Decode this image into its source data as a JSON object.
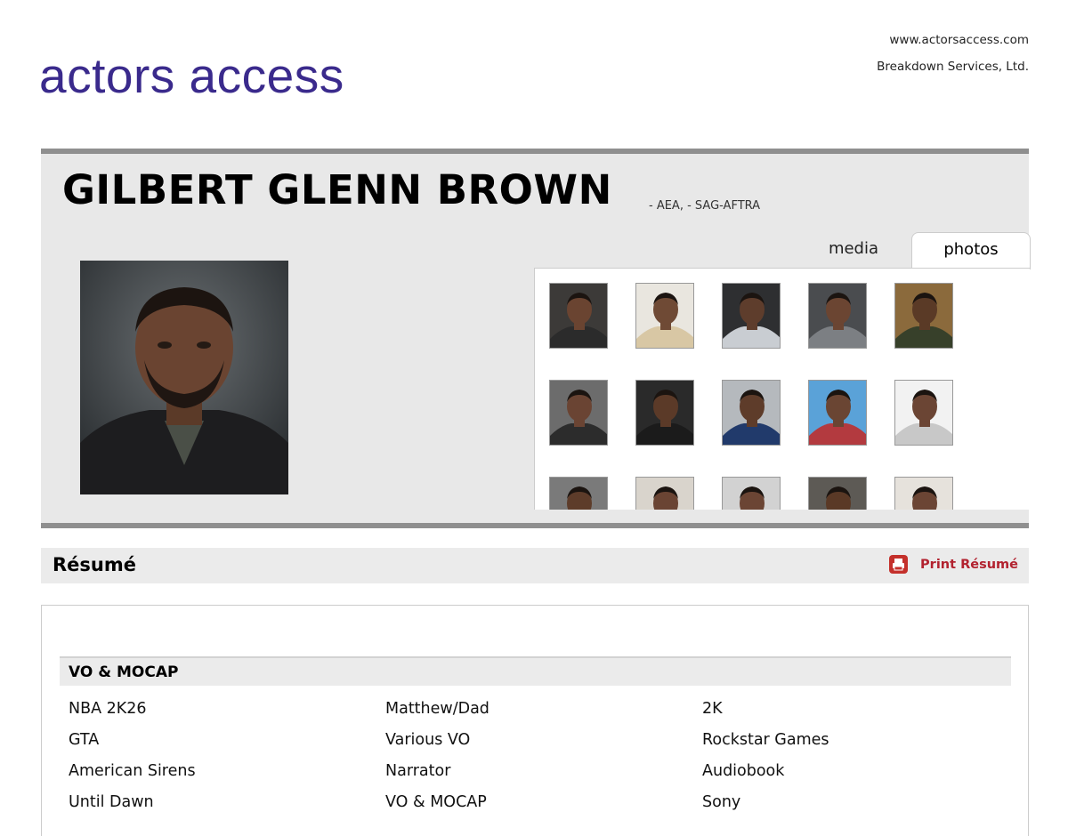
{
  "site": {
    "logo": "actors access",
    "url": "www.actorsaccess.com",
    "company": "Breakdown Services, Ltd."
  },
  "profile": {
    "name": "GILBERT GLENN BROWN",
    "unions": "- AEA, - SAG-AFTRA"
  },
  "tabs": {
    "media": "media",
    "photos": "photos",
    "active": "photos"
  },
  "thumbnails": [
    {
      "bg": "#3c3a38",
      "shirt": "#2b2b2b",
      "skin": "#6a4431"
    },
    {
      "bg": "#e9e6df",
      "shirt": "#d8c7a4",
      "skin": "#6f4a35"
    },
    {
      "bg": "#2e2f31",
      "shirt": "#c9cdd2",
      "skin": "#5e3d2c"
    },
    {
      "bg": "#4a4c4f",
      "shirt": "#7c7f83",
      "skin": "#6b4532"
    },
    {
      "bg": "#8b6a3c",
      "shirt": "#37402a",
      "skin": "#5a3a26"
    },
    {
      "bg": "#6c6c6c",
      "shirt": "#2c2c2c",
      "skin": "#6a4433"
    },
    {
      "bg": "#2a2a2a",
      "shirt": "#1b1b1b",
      "skin": "#5b3a28"
    },
    {
      "bg": "#b5b9bd",
      "shirt": "#213a6b",
      "skin": "#5e3c2a"
    },
    {
      "bg": "#5aa2d8",
      "shirt": "#b33a3f",
      "skin": "#6a4533"
    },
    {
      "bg": "#f2f2f2",
      "shirt": "#c8c8c8",
      "skin": "#6b4534"
    },
    {
      "bg": "#7a7a7a",
      "shirt": "#333333",
      "skin": "#5d3c2a"
    },
    {
      "bg": "#d9d4cc",
      "shirt": "#9c8b74",
      "skin": "#6a4433"
    },
    {
      "bg": "#d2d2d2",
      "shirt": "#555555",
      "skin": "#6b4534"
    },
    {
      "bg": "#5d5a55",
      "shirt": "#3a3a3a",
      "skin": "#5a3926"
    },
    {
      "bg": "#e6e2dc",
      "shirt": "#8a7a66",
      "skin": "#6b4534"
    }
  ],
  "resume": {
    "title": "Résumé",
    "print_label": "Print Résumé",
    "sections": [
      {
        "title": "VO & MOCAP",
        "rows": [
          [
            "NBA 2K26",
            "Matthew/Dad",
            "2K"
          ],
          [
            "GTA",
            "Various VO",
            "Rockstar Games"
          ],
          [
            "American Sirens",
            "Narrator",
            "Audiobook"
          ],
          [
            "Until Dawn",
            "VO & MOCAP",
            "Sony"
          ]
        ]
      }
    ]
  },
  "colors": {
    "logo": "#3a2a8c",
    "print_link": "#b2222f",
    "panel": "#e8e8e8"
  }
}
